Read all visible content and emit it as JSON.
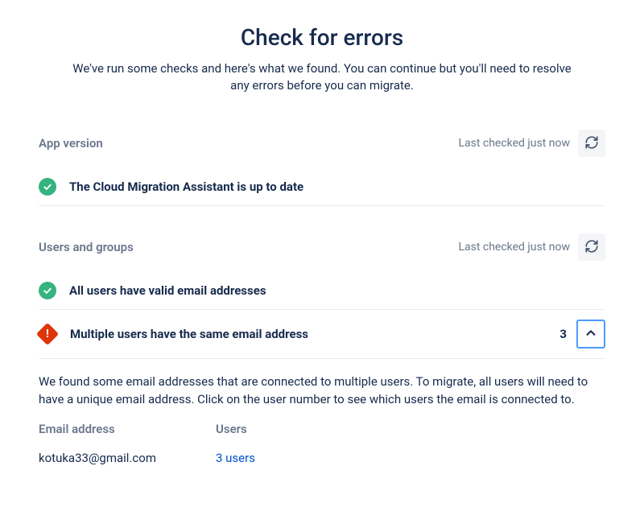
{
  "header": {
    "title": "Check for errors",
    "subtitle": "We've run some checks and here's what we found. You can continue but you'll need to resolve any errors before you can migrate."
  },
  "sections": {
    "appVersion": {
      "label": "App version",
      "lastChecked": "Last checked just now",
      "checks": {
        "upToDate": "The Cloud Migration Assistant is up to date"
      }
    },
    "usersGroups": {
      "label": "Users and groups",
      "lastChecked": "Last checked just now",
      "checks": {
        "validEmails": "All users have valid email addresses",
        "duplicateEmails": {
          "text": "Multiple users have the same email address",
          "count": "3",
          "detail": "We found some email addresses that are connected to multiple users. To migrate, all users will need to have a unique email address. Click on the user number to see which users the email is connected to.",
          "table": {
            "headerEmail": "Email address",
            "headerUsers": "Users",
            "rows": [
              {
                "email": "kotuka33@gmail.com",
                "usersLink": "3 users"
              }
            ]
          }
        }
      }
    }
  }
}
